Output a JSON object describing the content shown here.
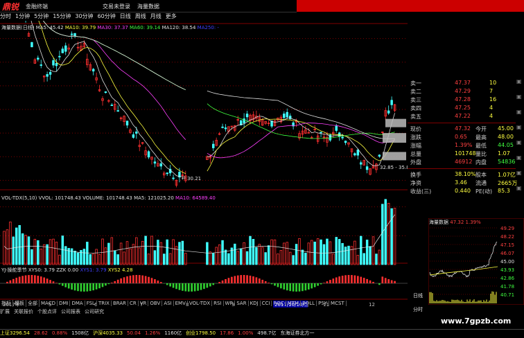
{
  "app": {
    "logo": "鼎锐",
    "logo_sub": "金融终端",
    "tabs": [
      "分时",
      "1分钟",
      "5分钟",
      "15分钟",
      "30分钟",
      "60分钟",
      "日线",
      "周线",
      "月线",
      "更多"
    ],
    "center_tabs": [
      "交易未登录",
      "海量数据"
    ]
  },
  "price_legend": {
    "title": "海量数据(日线)",
    "items": [
      {
        "label": "MA5: 45.42",
        "color": "#e0e0e0"
      },
      {
        "label": "MA10: 39.79",
        "color": "#ffff40"
      },
      {
        "label": "MA30: 37.37",
        "color": "#ff40ff"
      },
      {
        "label": "MA60: 39.14",
        "color": "#40ff40"
      },
      {
        "label": "MA120: 38.54",
        "color": "#e0e0e0"
      },
      {
        "label": "MA250: -",
        "color": "#4040ff"
      }
    ],
    "high_label": "73.77",
    "low_label": "30.21",
    "low2_label": "32.85 - 35.8"
  },
  "price_axis": [
    "60.00",
    "55.00",
    "50.00",
    "45.00",
    "40.00",
    "35.00",
    "30.00"
  ],
  "volume_legend": {
    "items": [
      {
        "label": "VOL-TDX(5,10)",
        "color": "#e0e0e0"
      },
      {
        "label": "VVOL: 101748.43",
        "color": "#e0e0e0"
      },
      {
        "label": "VOLUME: 101748.43",
        "color": "#e0e0e0"
      },
      {
        "label": "MA5: 121025.20",
        "color": "#e0e0e0"
      },
      {
        "label": "MA10: 64589.40",
        "color": "#ff40ff"
      }
    ]
  },
  "volume_axis": [
    "10000",
    "5000",
    "X10"
  ],
  "volume_marker": "4331",
  "indicator_legend": {
    "items": [
      {
        "label": "YJ-操舵季节",
        "color": "#e0e0e0"
      },
      {
        "label": "XYS0: 3.79",
        "color": "#e0e0e0"
      },
      {
        "label": "ZZK 0.00",
        "color": "#e0e0e0"
      },
      {
        "label": "XYS1: 3.79",
        "color": "#4040ff"
      },
      {
        "label": "XYS2 4.28",
        "color": "#ffff40"
      }
    ]
  },
  "indicator_axis": [
    "5.00"
  ],
  "date_axis": [
    "2017年",
    "5",
    "6",
    "7",
    "8",
    "9",
    "10",
    "11",
    "12"
  ],
  "date_highlight": "2017/10/10/二",
  "quote": {
    "sells": [
      {
        "label": "卖一",
        "price": "47.37",
        "vol": "10"
      },
      {
        "label": "卖二",
        "price": "47.29",
        "vol": "7"
      },
      {
        "label": "卖三",
        "price": "47.28",
        "vol": "16"
      },
      {
        "label": "卖四",
        "price": "47.25",
        "vol": "4"
      },
      {
        "label": "卖五",
        "price": "47.22",
        "vol": "4"
      }
    ],
    "stats": [
      {
        "l1": "现价",
        "v1": "47.32",
        "l2": "今开",
        "v2": "45.00",
        "c1": "red",
        "c2": "yellow"
      },
      {
        "l1": "涨跌",
        "v1": "0.65",
        "l2": "最高",
        "v2": "48.00",
        "c1": "red",
        "c2": "yellow"
      },
      {
        "l1": "涨幅",
        "v1": "1.39%",
        "l2": "最低",
        "v2": "44.05",
        "c1": "red",
        "c2": "green"
      },
      {
        "l1": "总量",
        "v1": "101748",
        "l2": "量比",
        "v2": "1.07",
        "c1": "yellow",
        "c2": "yellow"
      },
      {
        "l1": "外盘",
        "v1": "46912",
        "l2": "内盘",
        "v2": "54836",
        "c1": "red",
        "c2": "green"
      }
    ],
    "stats2": [
      {
        "l1": "换手",
        "v1": "38.10%",
        "l2": "股本",
        "v2": "1.07亿"
      },
      {
        "l1": "净资",
        "v1": "3.46",
        "l2": "流通",
        "v2": "2665万"
      },
      {
        "l1": "收益(三)",
        "v1": "0.440",
        "l2": "PE(动)",
        "v2": "85.3"
      }
    ]
  },
  "minichart": {
    "title": "海量数据",
    "price": "47.32",
    "pct": "1.39%",
    "axis": [
      "49.29",
      "48.22",
      "47.15",
      "46.07",
      "45.00",
      "43.93",
      "42.86",
      "41.78",
      "40.71"
    ]
  },
  "right_tabs": [
    "日线",
    "分时"
  ],
  "bottom_tabs": [
    "指标",
    "模板",
    "全部",
    "MACD",
    "DMI",
    "DMA",
    "FSL",
    "TRIX",
    "BRAR",
    "CR",
    "VR",
    "OBV",
    "ASI",
    "EMV",
    "VOL-TDX",
    "RSI",
    "WR",
    "SAR",
    "KDJ",
    "CCI",
    "ROC",
    "MTM",
    "BOLL",
    "PSY",
    "MCST"
  ],
  "bottom_tabs2": [
    "扩展",
    "关联报价",
    "个股点评",
    "公司报表",
    "公司研究"
  ],
  "status": [
    {
      "text": "上证3296.54",
      "color": "#ffff40"
    },
    {
      "text": "28.62",
      "color": "#ff4040"
    },
    {
      "text": "0.88%",
      "color": "#ff4040"
    },
    {
      "text": "1508亿",
      "color": "#e0e0e0"
    },
    {
      "text": "沪深4035.33",
      "color": "#ffff40"
    },
    {
      "text": "50.04",
      "color": "#ff4040"
    },
    {
      "text": "1.26%",
      "color": "#ff4040"
    },
    {
      "text": "1160亿",
      "color": "#e0e0e0"
    },
    {
      "text": "创业1798.50",
      "color": "#ffff40"
    },
    {
      "text": "17.86",
      "color": "#ff4040"
    },
    {
      "text": "1.00%",
      "color": "#ff4040"
    },
    {
      "text": "498.7亿",
      "color": "#e0e0e0"
    },
    {
      "text": "东海证券北方一",
      "color": "#e0e0e0"
    }
  ],
  "watermark": "www.7gpzb.com",
  "colors": {
    "up": "#ff3030",
    "down": "#40ffff",
    "bg": "#000000",
    "grid": "#800000"
  }
}
